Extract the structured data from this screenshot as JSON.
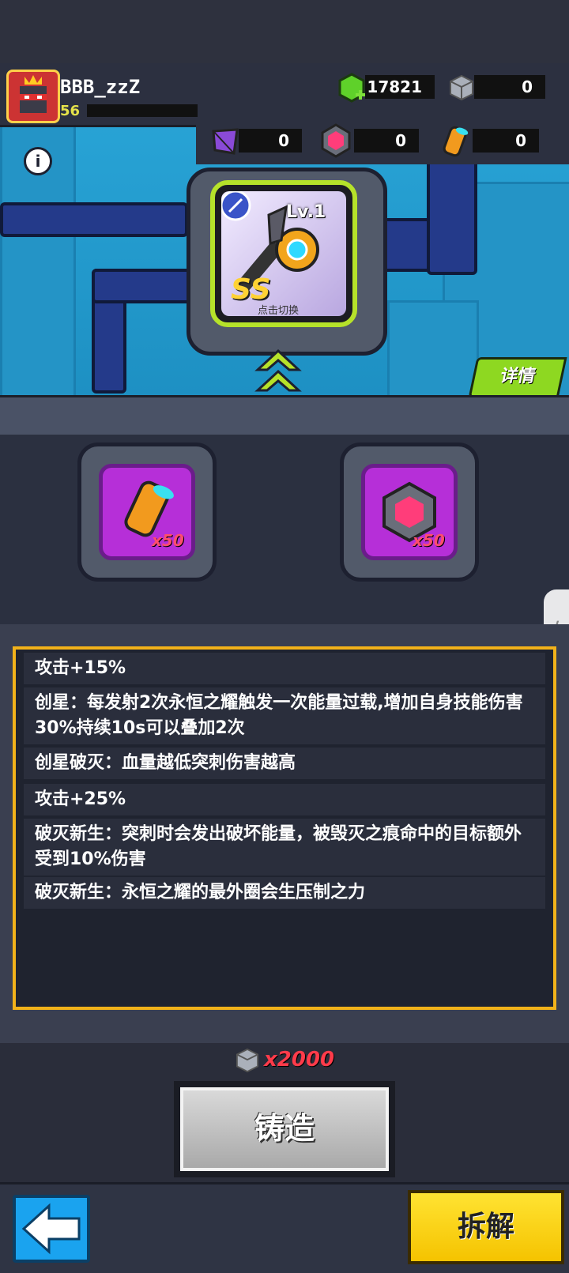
{
  "player": {
    "name": "BBB_zzZ",
    "level": "56"
  },
  "resources": {
    "gems": "17821",
    "cubes": "0",
    "shards": "0",
    "pink_cores": "0",
    "canisters": "0"
  },
  "weapon": {
    "level_label": "Lv.1",
    "grade": "SS",
    "switch_hint": "点击切换"
  },
  "buttons": {
    "details": "详情",
    "forge": "铸造",
    "dismantle": "拆解"
  },
  "materials": [
    {
      "icon": "canister-icon",
      "qty": "x50"
    },
    {
      "icon": "pink-core-icon",
      "qty": "x50"
    }
  ],
  "stats": [
    "攻击+15%",
    "创星：每发射2次永恒之耀触发一次能量过载,增加自身技能伤害30%持续10s可以叠加2次",
    "创星破灭：血量越低突刺伤害越高",
    "攻击+25%",
    "破灭新生：突刺时会发出破坏能量，被毁灭之痕命中的目标额外受到10%伤害",
    "破灭新生：永恒之耀的最外圈会生压制之力"
  ],
  "cost": "x2000",
  "colors": {
    "accent_green": "#8ed821",
    "panel_border": "#f2b21a",
    "forge_gray": "#bfbfbf",
    "dismantle_yellow": "#ffd816",
    "back_blue": "#1aa3ef"
  }
}
